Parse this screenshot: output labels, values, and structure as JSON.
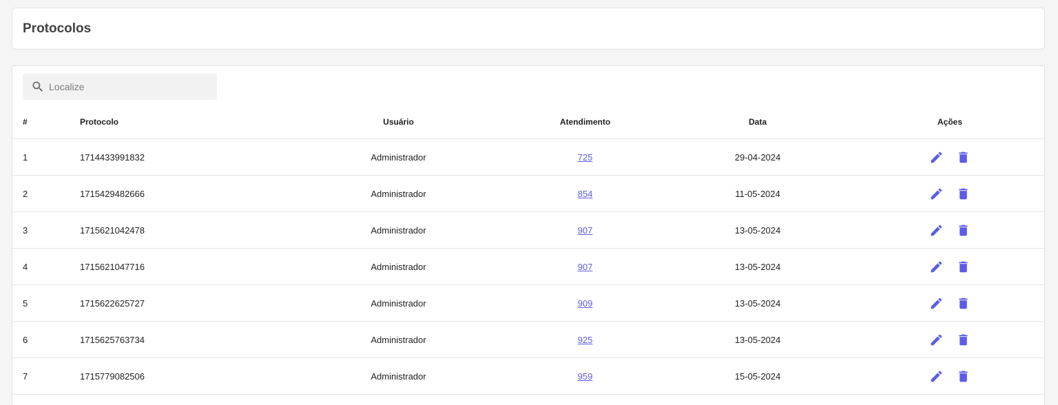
{
  "header": {
    "title": "Protocolos"
  },
  "search": {
    "placeholder": "Localize",
    "value": "",
    "icon": "search-icon"
  },
  "table": {
    "columns": {
      "num": "#",
      "protocolo": "Protocolo",
      "usuario": "Usuário",
      "atendimento": "Atendimento",
      "data": "Data",
      "acoes": "Ações"
    },
    "rows": [
      {
        "num": "1",
        "protocolo": "1714433991832",
        "usuario": "Administrador",
        "atendimento": "725",
        "data": "29-04-2024"
      },
      {
        "num": "2",
        "protocolo": "1715429482666",
        "usuario": "Administrador",
        "atendimento": "854",
        "data": "11-05-2024"
      },
      {
        "num": "3",
        "protocolo": "1715621042478",
        "usuario": "Administrador",
        "atendimento": "907",
        "data": "13-05-2024"
      },
      {
        "num": "4",
        "protocolo": "1715621047716",
        "usuario": "Administrador",
        "atendimento": "907",
        "data": "13-05-2024"
      },
      {
        "num": "5",
        "protocolo": "1715622625727",
        "usuario": "Administrador",
        "atendimento": "909",
        "data": "13-05-2024"
      },
      {
        "num": "6",
        "protocolo": "1715625763734",
        "usuario": "Administrador",
        "atendimento": "925",
        "data": "13-05-2024"
      },
      {
        "num": "7",
        "protocolo": "1715779082506",
        "usuario": "Administrador",
        "atendimento": "959",
        "data": "15-05-2024"
      }
    ],
    "row_actions": [
      "edit-icon",
      "delete-icon"
    ]
  },
  "colors": {
    "accent": "#5c5ce6",
    "background": "#f5f5f5",
    "card": "#ffffff",
    "search_bg": "#f2f2f2"
  }
}
